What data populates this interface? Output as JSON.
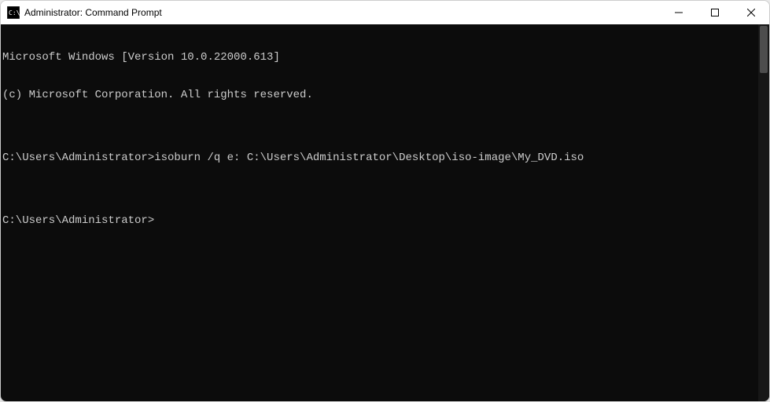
{
  "window": {
    "title": "Administrator: Command Prompt"
  },
  "terminal": {
    "lines": [
      "Microsoft Windows [Version 10.0.22000.613]",
      "(c) Microsoft Corporation. All rights reserved.",
      "",
      "C:\\Users\\Administrator>isoburn /q e: C:\\Users\\Administrator\\Desktop\\iso-image\\My_DVD.iso",
      "",
      "C:\\Users\\Administrator>"
    ]
  }
}
